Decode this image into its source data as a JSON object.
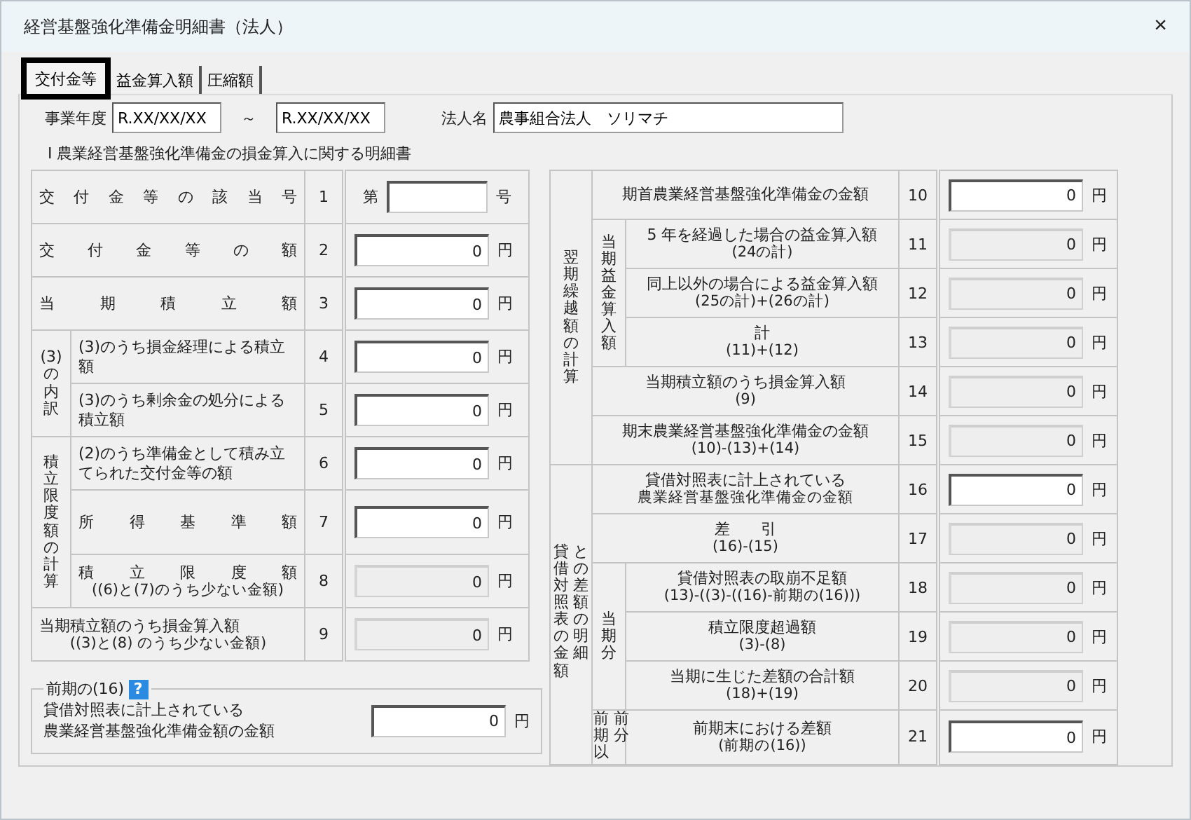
{
  "window": {
    "title": "経営基盤強化準備金明細書（法人）",
    "close": "×"
  },
  "tabs": [
    {
      "label": "交付金等",
      "selected": true
    },
    {
      "label": "益金算入額",
      "selected": false
    },
    {
      "label": "圧縮額",
      "selected": false
    }
  ],
  "period": {
    "label": "事業年度",
    "from": "R.XX/XX/XX",
    "separator": "～",
    "to": "R.XX/XX/XX"
  },
  "corporation": {
    "label": "法人名",
    "value": "農事組合法人　ソリマチ"
  },
  "section_title": "Ⅰ 農業経営基盤強化準備金の損金算入に関する明細書",
  "left_table": {
    "rows": [
      {
        "no": "1",
        "label": "交付金等の該当号",
        "spread": true,
        "prefix": "第",
        "unit": "号",
        "disabled": false
      },
      {
        "no": "2",
        "label": "交付金等の額",
        "spread": true,
        "value": "0",
        "unit": "円",
        "disabled": false
      },
      {
        "no": "3",
        "label": "当期積立額",
        "spread": true,
        "value": "0",
        "unit": "円",
        "disabled": false
      },
      {
        "label": "(3)の内訳",
        "kind": "vertical",
        "rows": [
          {
            "no": "4",
            "label": "(3)のうち損金経理による積立額",
            "spread": false,
            "value": "0",
            "unit": "円",
            "disabled": false
          },
          {
            "no": "5",
            "label": "(3)のうち剰余金の処分による積立額",
            "spread": false,
            "value": "0",
            "unit": "円",
            "disabled": false
          }
        ]
      },
      {
        "label": "積立限度額の計算",
        "kind": "vertical",
        "rows": [
          {
            "no": "6",
            "label": "(2)のうち準備金として積み立てられた交付金等の額",
            "spread": false,
            "value": "0",
            "unit": "円",
            "disabled": false
          },
          {
            "no": "7",
            "label": "所得基準額",
            "spread": true,
            "value": "0",
            "unit": "円",
            "disabled": false
          },
          {
            "no": "8",
            "label": "積立限度額",
            "spread": true,
            "note": "((6)と(7)のうち少ない金額)",
            "value": "0",
            "unit": "円",
            "disabled": true
          }
        ]
      },
      {
        "no": "9",
        "label": "当期積立額のうち損金算入額",
        "spread": false,
        "note": "((3)と(8) のうち少ない金額)",
        "value": "0",
        "unit": "円",
        "disabled": true
      }
    ]
  },
  "previous": {
    "legend": "前期の(16)",
    "help": "?",
    "lines": [
      "貸借対照表に計上されている",
      "農業経営基盤強化準備金額の金額"
    ],
    "value": "0",
    "unit": "円"
  },
  "right_table": {
    "rows": [
      {
        "label": "翌期繰越額の計算",
        "kind": "vertical",
        "rows": [
          {
            "no": "10",
            "label": "期首農業経営基盤強化準備金の金額",
            "spread": false,
            "value": "0",
            "unit": "円",
            "disabled": false
          },
          {
            "label": "当期益金算入額",
            "kind": "vertical",
            "rows": [
              {
                "no": "11",
                "label": "5 年を経過した場合の益金算入額",
                "spread": false,
                "note": "(24の計)",
                "value": "0",
                "unit": "円",
                "disabled": true
              },
              {
                "no": "12",
                "label": "同上以外の場合による益金算入額",
                "spread": false,
                "note": "(25の計)+(26の計)",
                "value": "0",
                "unit": "円",
                "disabled": true
              },
              {
                "no": "13",
                "label": "計",
                "spread": false,
                "note": "(11)+(12)",
                "value": "0",
                "unit": "円",
                "disabled": true
              }
            ]
          },
          {
            "no": "14",
            "label": "当期積立額のうち損金算入額",
            "spread": false,
            "note": "(9)",
            "value": "0",
            "unit": "円",
            "disabled": true
          },
          {
            "no": "15",
            "label": "期末農業経営基盤強化準備金の金額",
            "spread": false,
            "note": "(10)-(13)+(14)",
            "value": "0",
            "unit": "円",
            "disabled": true
          }
        ]
      },
      {
        "label": "貸借対照表の金額との差額の明細",
        "kind": "vertical-double",
        "rows": [
          {
            "no": "16",
            "label": "貸借対照表に計上されている",
            "spread": false,
            "note": "農業経営基盤強化準備金の金額",
            "value": "0",
            "unit": "円",
            "disabled": false
          },
          {
            "no": "17",
            "label": "差　　引",
            "spread": false,
            "note": "(16)-(15)",
            "value": "0",
            "unit": "円",
            "disabled": true
          },
          {
            "label": "当期分",
            "kind": "vertical",
            "rows": [
              {
                "no": "18",
                "label": "貸借対照表の取崩不足額",
                "spread": false,
                "note": "(13)-((3)-((16)-前期の(16)))",
                "value": "0",
                "unit": "円",
                "disabled": true
              },
              {
                "no": "19",
                "label": "積立限度超過額",
                "spread": false,
                "note": "(3)-(8)",
                "value": "0",
                "unit": "円",
                "disabled": true
              },
              {
                "no": "20",
                "label": "当期に生じた差額の合計額",
                "spread": false,
                "note": "(18)+(19)",
                "value": "0",
                "unit": "円",
                "disabled": true
              }
            ]
          },
          {
            "label": "前期以前分",
            "kind": "vertical-double",
            "rows": [
              {
                "no": "21",
                "label": "前期末における差額",
                "spread": false,
                "note": "(前期の(16))",
                "value": "0",
                "unit": "円",
                "disabled": false
              }
            ]
          }
        ]
      }
    ]
  }
}
